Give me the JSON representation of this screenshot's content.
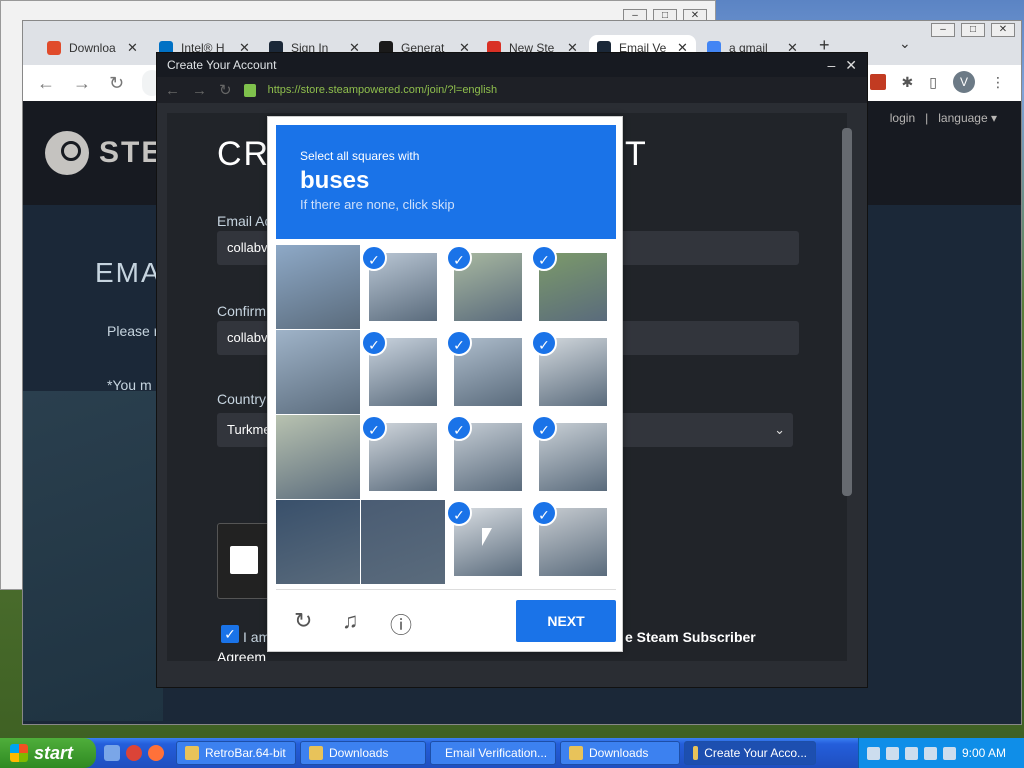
{
  "browser": {
    "tabs": [
      {
        "label": "Downloa",
        "color": "#e04b2b"
      },
      {
        "label": "Intel® H",
        "color": "#0071c5"
      },
      {
        "label": "Sign In",
        "color": "#1b2838"
      },
      {
        "label": "Generat",
        "color": "#1a1a1a"
      },
      {
        "label": "New Ste",
        "color": "#d93025"
      },
      {
        "label": "Email Ve",
        "color": "#1b2838"
      },
      {
        "label": "a gmail",
        "color": "#4285f4"
      }
    ],
    "active_tab_index": 5,
    "avatar_letter": "V",
    "new_tab_symbol": "+",
    "tab_search_symbol": "⌄"
  },
  "steam": {
    "logo_text": "STEA",
    "header_links": [
      "login",
      "|",
      "language ▾"
    ],
    "email_heading": "EMA",
    "please_text": "Please r",
    "you_may_text": "*You m"
  },
  "popup": {
    "title": "Create Your Account",
    "url": "https://store.steampowered.com/join/?l=english",
    "create_title_left": "CR",
    "create_title_right": "T",
    "email_label": "Email Ac",
    "email_value": "collabv",
    "confirm_label": "Confirm",
    "confirm_value": "collabv",
    "country_label": "Country",
    "country_value": "Turkme",
    "agree_left": "I am",
    "agree_right": "e Steam Subscriber",
    "agree_line2": "Agreem"
  },
  "captcha": {
    "instruction": "Select all squares with",
    "target": "buses",
    "hint": "If there are none, click skip",
    "next_label": "NEXT",
    "check_mark": "✓",
    "selected": [
      false,
      true,
      true,
      true,
      false,
      true,
      true,
      true,
      false,
      true,
      true,
      true,
      false,
      false,
      true,
      true
    ]
  },
  "taskbar": {
    "start_label": "start",
    "buttons": [
      {
        "label": "RetroBar.64-bit",
        "active": false
      },
      {
        "label": "Downloads",
        "active": false
      },
      {
        "label": "Email Verification...",
        "active": false
      },
      {
        "label": "Downloads",
        "active": false
      },
      {
        "label": "Create Your Acco...",
        "active": true
      }
    ],
    "clock": "9:00 AM"
  }
}
